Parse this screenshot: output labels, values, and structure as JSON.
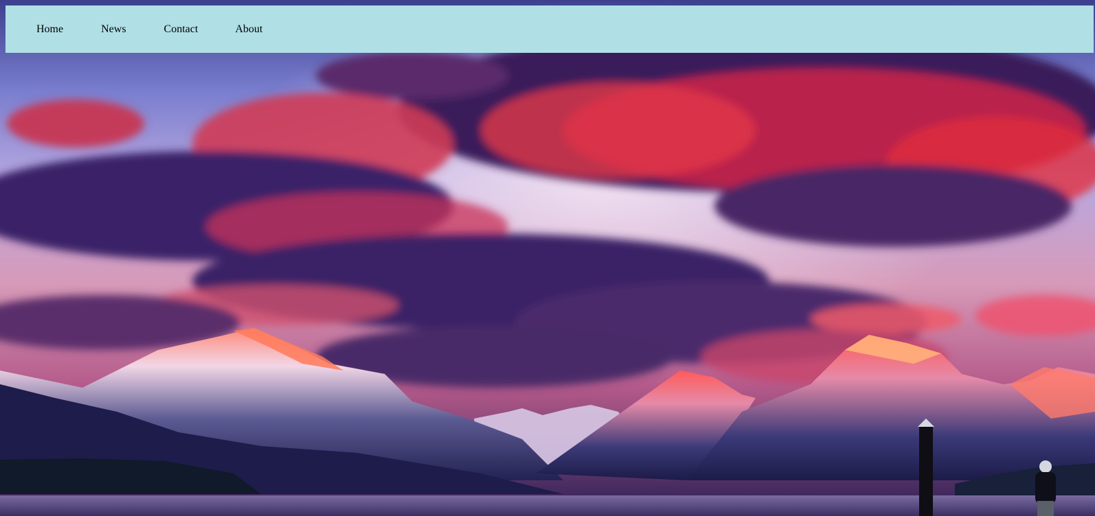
{
  "nav": {
    "items": [
      {
        "label": "Home"
      },
      {
        "label": "News"
      },
      {
        "label": "Contact"
      },
      {
        "label": "About"
      }
    ],
    "background_color": "#b0e0e6"
  },
  "hero": {
    "description_colors": {
      "sky_top": "#6a6fc0",
      "cloud_red": "#e8324a",
      "cloud_purple": "#3a2470",
      "mountain_glow": "#ff6a5a",
      "water": "#6a5a8a"
    }
  }
}
